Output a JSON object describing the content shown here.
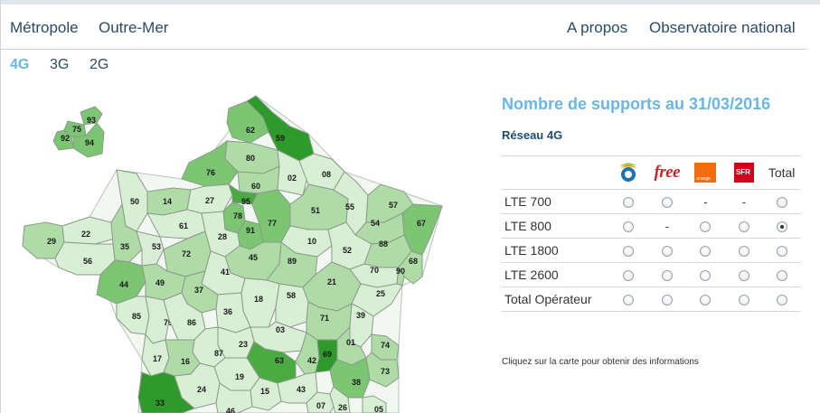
{
  "nav": {
    "left": [
      "Métropole",
      "Outre-Mer"
    ],
    "right": [
      "A propos",
      "Observatoire national"
    ]
  },
  "tech_tabs": {
    "items": [
      "4G",
      "3G",
      "2G"
    ],
    "active": "4G"
  },
  "panel": {
    "title": "Nombre de supports au 31/03/2016",
    "subtitle": "Réseau 4G",
    "operators": [
      {
        "name": "Bouygues",
        "logo": "bouygues-logo"
      },
      {
        "name": "Free",
        "logo": "free-logo",
        "logo_text": "free"
      },
      {
        "name": "Orange",
        "logo": "orange-logo",
        "logo_text": "orange"
      },
      {
        "name": "SFR",
        "logo": "sfr-logo",
        "logo_text": "SFR"
      }
    ],
    "total_header": "Total",
    "rows": [
      {
        "label": "LTE 700",
        "cells": [
          "radio",
          "radio",
          "-",
          "-",
          "radio"
        ]
      },
      {
        "label": "LTE 800",
        "cells": [
          "radio",
          "-",
          "radio",
          "radio",
          "radio-checked"
        ]
      },
      {
        "label": "LTE 1800",
        "cells": [
          "radio",
          "radio",
          "radio",
          "radio",
          "radio"
        ]
      },
      {
        "label": "LTE 2600",
        "cells": [
          "radio",
          "radio",
          "radio",
          "radio",
          "radio"
        ]
      },
      {
        "label": "Total Opérateur",
        "cells": [
          "radio",
          "radio",
          "radio",
          "radio",
          "radio"
        ]
      }
    ],
    "hint": "Cliquez sur la carte pour obtenir des informations"
  },
  "colors": {
    "accent": "#6ab6e6",
    "nav_text": "#2a4a66",
    "shade_1": "#d9efd5",
    "shade_2": "#aedba6",
    "shade_3": "#7cc673",
    "shade_4": "#4aab43",
    "shade_5": "#2f9a2c",
    "orange_brand": "#f26c0d",
    "sfr_brand": "#d2001c",
    "free_brand": "#d32027"
  },
  "map": {
    "departments": [
      {
        "code": "93",
        "shade": 3
      },
      {
        "code": "75",
        "shade": 3
      },
      {
        "code": "92",
        "shade": 3
      },
      {
        "code": "94",
        "shade": 3
      },
      {
        "code": "62",
        "shade": 3
      },
      {
        "code": "59",
        "shade": 5
      },
      {
        "code": "80",
        "shade": 2
      },
      {
        "code": "76",
        "shade": 3
      },
      {
        "code": "60",
        "shade": 2
      },
      {
        "code": "02",
        "shade": 1
      },
      {
        "code": "08",
        "shade": 1
      },
      {
        "code": "50",
        "shade": 1
      },
      {
        "code": "14",
        "shade": 2
      },
      {
        "code": "27",
        "shade": 1
      },
      {
        "code": "95",
        "shade": 4
      },
      {
        "code": "78",
        "shade": 3
      },
      {
        "code": "77",
        "shade": 3
      },
      {
        "code": "91",
        "shade": 3
      },
      {
        "code": "51",
        "shade": 2
      },
      {
        "code": "55",
        "shade": 1
      },
      {
        "code": "57",
        "shade": 2
      },
      {
        "code": "67",
        "shade": 3
      },
      {
        "code": "54",
        "shade": 2
      },
      {
        "code": "61",
        "shade": 1
      },
      {
        "code": "28",
        "shade": 1
      },
      {
        "code": "10",
        "shade": 1
      },
      {
        "code": "52",
        "shade": 1
      },
      {
        "code": "88",
        "shade": 2
      },
      {
        "code": "68",
        "shade": 2
      },
      {
        "code": "29",
        "shade": 2
      },
      {
        "code": "22",
        "shade": 1
      },
      {
        "code": "35",
        "shade": 2
      },
      {
        "code": "53",
        "shade": 1
      },
      {
        "code": "72",
        "shade": 2
      },
      {
        "code": "45",
        "shade": 2
      },
      {
        "code": "89",
        "shade": 2
      },
      {
        "code": "56",
        "shade": 1
      },
      {
        "code": "41",
        "shade": 1
      },
      {
        "code": "70",
        "shade": 1
      },
      {
        "code": "90",
        "shade": 2
      },
      {
        "code": "44",
        "shade": 3
      },
      {
        "code": "49",
        "shade": 2
      },
      {
        "code": "37",
        "shade": 2
      },
      {
        "code": "21",
        "shade": 2
      },
      {
        "code": "25",
        "shade": 1
      },
      {
        "code": "18",
        "shade": 1
      },
      {
        "code": "58",
        "shade": 1
      },
      {
        "code": "36",
        "shade": 1
      },
      {
        "code": "85",
        "shade": 1
      },
      {
        "code": "79",
        "shade": 1
      },
      {
        "code": "86",
        "shade": 1
      },
      {
        "code": "71",
        "shade": 2
      },
      {
        "code": "39",
        "shade": 1
      },
      {
        "code": "03",
        "shade": 1
      },
      {
        "code": "23",
        "shade": 1
      },
      {
        "code": "87",
        "shade": 1
      },
      {
        "code": "01",
        "shade": 2
      },
      {
        "code": "74",
        "shade": 2
      },
      {
        "code": "17",
        "shade": 1
      },
      {
        "code": "16",
        "shade": 2
      },
      {
        "code": "63",
        "shade": 4
      },
      {
        "code": "42",
        "shade": 2
      },
      {
        "code": "69",
        "shade": 5
      },
      {
        "code": "73",
        "shade": 2
      },
      {
        "code": "19",
        "shade": 1
      },
      {
        "code": "38",
        "shade": 3
      },
      {
        "code": "24",
        "shade": 1
      },
      {
        "code": "15",
        "shade": 1
      },
      {
        "code": "43",
        "shade": 1
      },
      {
        "code": "33",
        "shade": 5
      },
      {
        "code": "46",
        "shade": 1
      },
      {
        "code": "07",
        "shade": 1
      },
      {
        "code": "26",
        "shade": 1
      },
      {
        "code": "05",
        "shade": 1
      }
    ]
  }
}
